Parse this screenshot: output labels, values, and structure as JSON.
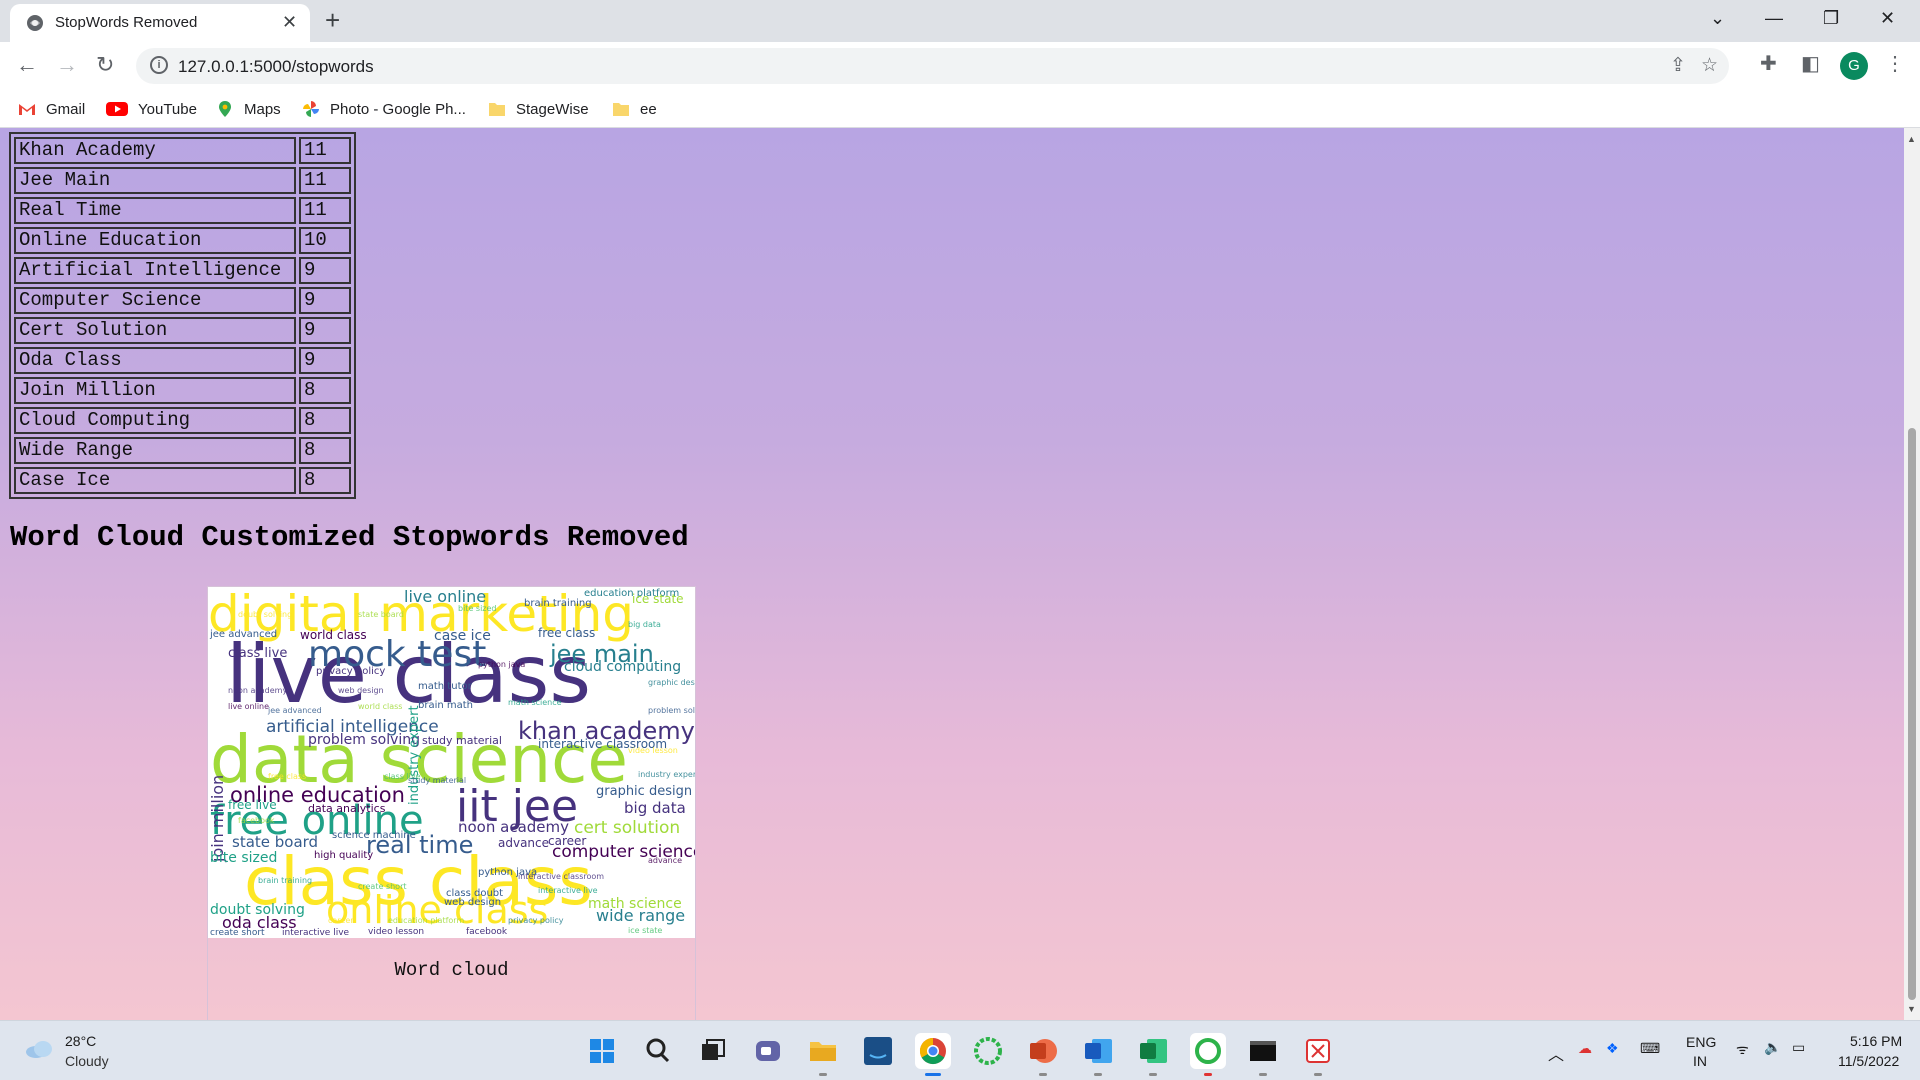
{
  "browser": {
    "tab_title": "StopWords Removed",
    "url": "127.0.0.1:5000/stopwords",
    "bookmarks": [
      "Gmail",
      "YouTube",
      "Maps",
      "Photo - Google Ph...",
      "StageWise",
      "ee"
    ],
    "profile_initial": "G"
  },
  "table": {
    "rows": [
      {
        "term": "Khan Academy",
        "count": "11"
      },
      {
        "term": "Jee Main",
        "count": "11"
      },
      {
        "term": "Real Time",
        "count": "11"
      },
      {
        "term": "Online Education",
        "count": "10"
      },
      {
        "term": "Artificial Intelligence",
        "count": "9"
      },
      {
        "term": "Computer Science",
        "count": "9"
      },
      {
        "term": "Cert Solution",
        "count": "9"
      },
      {
        "term": "Oda Class",
        "count": "9"
      },
      {
        "term": "Join Million",
        "count": "8"
      },
      {
        "term": "Cloud Computing",
        "count": "8"
      },
      {
        "term": "Wide Range",
        "count": "8"
      },
      {
        "term": "Case Ice",
        "count": "8"
      }
    ]
  },
  "section": {
    "title": "Word Cloud Customized Stopwords Removed",
    "caption": "Word cloud"
  },
  "wordcloud": {
    "words": [
      "digital marketing",
      "live class",
      "data science",
      "class class",
      "mock test",
      "free online",
      "iit jee",
      "online class",
      "jee main",
      "khan academy",
      "real time",
      "online education",
      "artificial intelligence",
      "computer science",
      "cert solution",
      "cloud computing",
      "wide range",
      "join million",
      "case ice",
      "oda class",
      "doubt solving",
      "state board",
      "bite sized",
      "big data",
      "graphic design",
      "problem solving",
      "noon academy",
      "live online",
      "free class",
      "world class",
      "class live",
      "math science",
      "industry expert",
      "study material",
      "interactive classroom",
      "advance",
      "career",
      "education platform",
      "ice state",
      "brain training",
      "privacy policy",
      "jee advanced",
      "web design",
      "python java",
      "video lesson",
      "facebook",
      "create short",
      "interactive live",
      "data analytics",
      "science machine",
      "high quality",
      "class doubt",
      "free live",
      "brain math",
      "math tutor"
    ],
    "palette": [
      "#fde725",
      "#a0da39",
      "#4ac16d",
      "#1fa187",
      "#277f8e",
      "#365c8d",
      "#46327e",
      "#440154"
    ]
  },
  "taskbar": {
    "temperature": "28°C",
    "condition": "Cloudy",
    "language": "ENG",
    "region": "IN",
    "time": "5:16 PM",
    "date": "11/5/2022"
  }
}
